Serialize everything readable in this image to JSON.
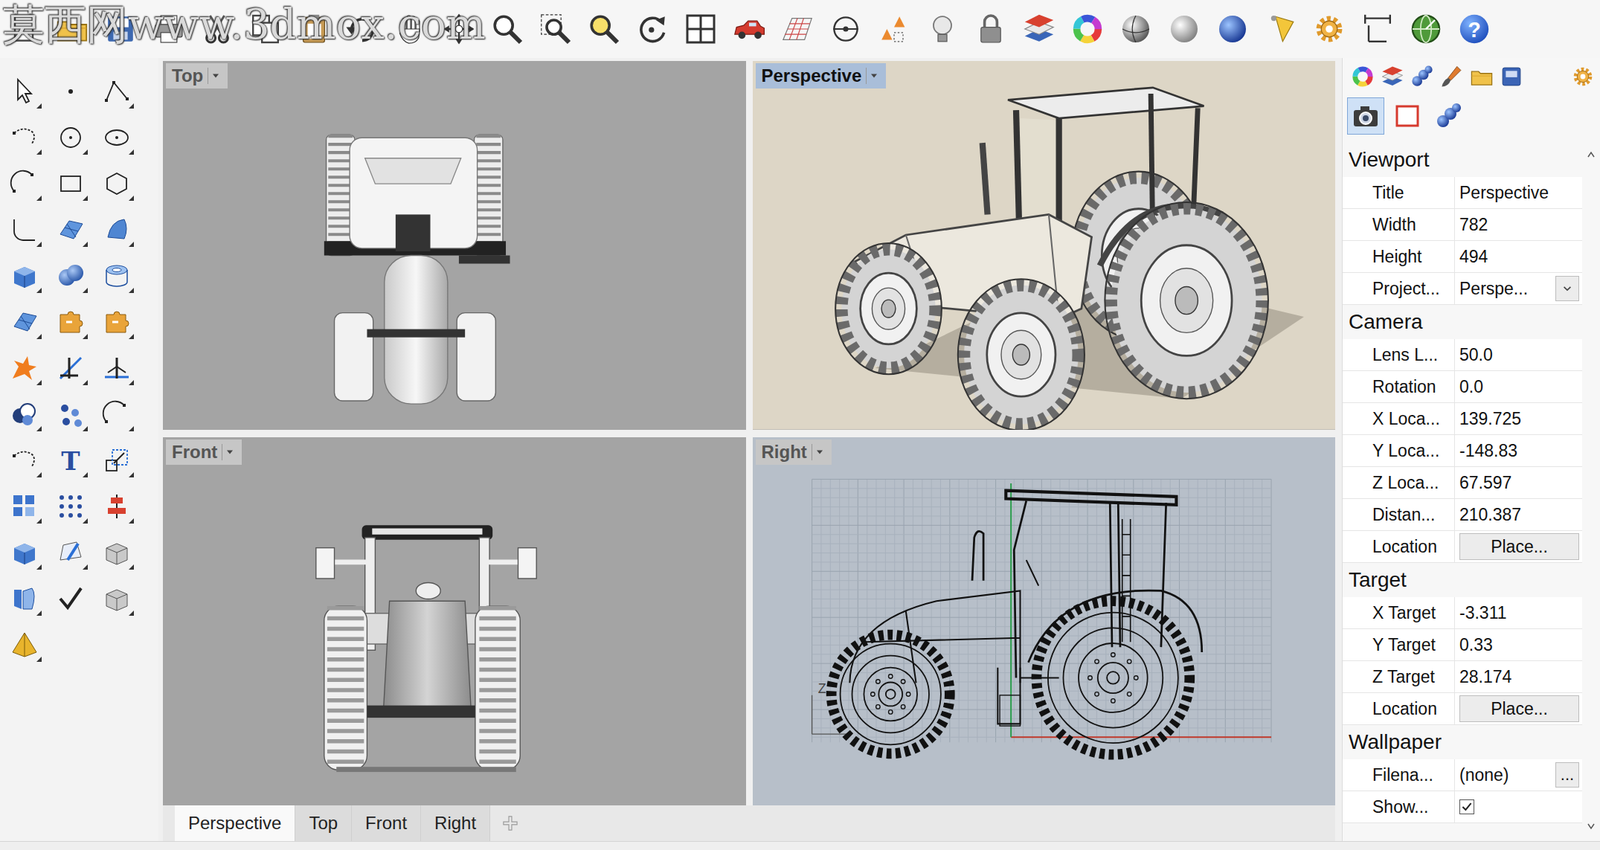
{
  "watermark": "莫西网www.3dmox.com",
  "icon_glyphs": {
    "text_tool": "T",
    "help": "?"
  },
  "viewports": [
    {
      "title": "Top",
      "selected": false,
      "kind": "plan"
    },
    {
      "title": "Perspective",
      "selected": true,
      "kind": "rendered"
    },
    {
      "title": "Front",
      "selected": false,
      "kind": "elevation"
    },
    {
      "title": "Right",
      "selected": false,
      "kind": "wireframe",
      "axis_label": "Z"
    }
  ],
  "view_tabs": [
    {
      "label": "Perspective",
      "selected": true
    },
    {
      "label": "Top",
      "selected": false
    },
    {
      "label": "Front",
      "selected": false
    },
    {
      "label": "Right",
      "selected": false
    }
  ],
  "panel_buttons": [
    {
      "selected": true
    },
    {
      "selected": false
    },
    {
      "selected": false
    }
  ],
  "properties": [
    {
      "title": "Viewport",
      "rows": [
        {
          "label": "Title",
          "value": "Perspective",
          "kind": "text"
        },
        {
          "label": "Width",
          "value": "782",
          "kind": "text"
        },
        {
          "label": "Height",
          "value": "494",
          "kind": "text"
        },
        {
          "label": "Project...",
          "value": "Perspe...",
          "kind": "dropdown"
        }
      ]
    },
    {
      "title": "Camera",
      "rows": [
        {
          "label": "Lens L...",
          "value": "50.0",
          "kind": "text"
        },
        {
          "label": "Rotation",
          "value": "0.0",
          "kind": "text"
        },
        {
          "label": "X Loca...",
          "value": "139.725",
          "kind": "text"
        },
        {
          "label": "Y Loca...",
          "value": "-148.83",
          "kind": "text"
        },
        {
          "label": "Z Loca...",
          "value": "67.597",
          "kind": "text"
        },
        {
          "label": "Distan...",
          "value": "210.387",
          "kind": "text"
        },
        {
          "label": "Location",
          "value": "Place...",
          "kind": "button"
        }
      ]
    },
    {
      "title": "Target",
      "rows": [
        {
          "label": "X Target",
          "value": "-3.311",
          "kind": "text"
        },
        {
          "label": "Y Target",
          "value": "0.33",
          "kind": "text"
        },
        {
          "label": "Z Target",
          "value": "28.174",
          "kind": "text"
        },
        {
          "label": "Location",
          "value": "Place...",
          "kind": "button"
        }
      ]
    },
    {
      "title": "Wallpaper",
      "rows": [
        {
          "label": "Filena...",
          "value": "(none)",
          "kind": "browse",
          "button": "..."
        },
        {
          "label": "Show...",
          "kind": "checkbox",
          "checked": true
        }
      ]
    }
  ]
}
